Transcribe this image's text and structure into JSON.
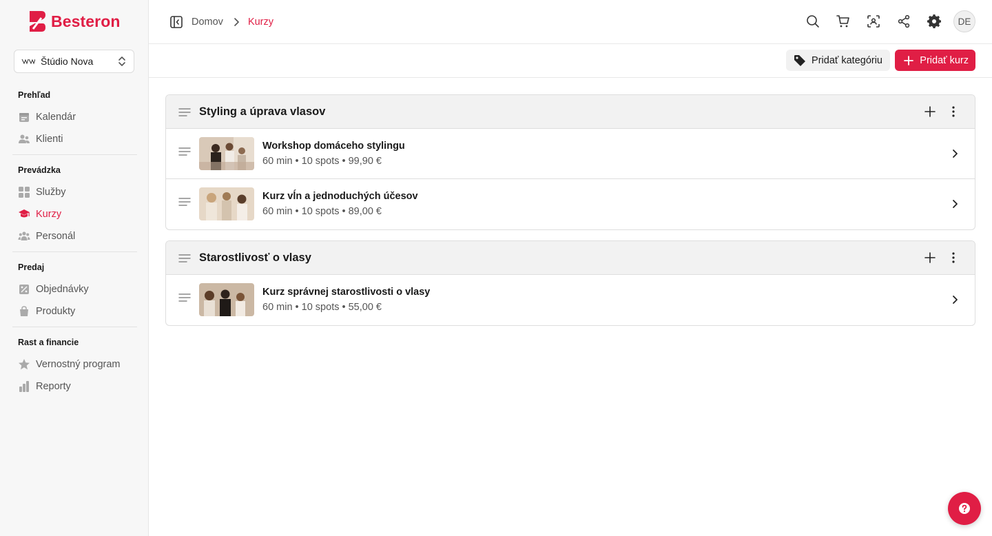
{
  "brand": {
    "name": "Besteron",
    "accent": "#e01e45"
  },
  "studio": {
    "name": "Štúdio Nova"
  },
  "sidebar": {
    "groups": [
      {
        "title": "Prehľad",
        "items": [
          {
            "label": "Kalendár",
            "icon": "calendar-icon"
          },
          {
            "label": "Klienti",
            "icon": "users-icon"
          }
        ]
      },
      {
        "title": "Prevádzka",
        "items": [
          {
            "label": "Služby",
            "icon": "grid-icon"
          },
          {
            "label": "Kurzy",
            "icon": "graduation-cap-icon",
            "active": true
          },
          {
            "label": "Personál",
            "icon": "team-icon"
          }
        ]
      },
      {
        "title": "Predaj",
        "items": [
          {
            "label": "Objednávky",
            "icon": "order-icon"
          },
          {
            "label": "Produkty",
            "icon": "bag-icon"
          }
        ]
      },
      {
        "title": "Rast a financie",
        "items": [
          {
            "label": "Vernostný program",
            "icon": "star-icon"
          },
          {
            "label": "Reporty",
            "icon": "bar-chart-icon"
          }
        ]
      }
    ]
  },
  "breadcrumb": {
    "home": "Domov",
    "current": "Kurzy"
  },
  "topbar": {
    "icons": [
      "search-icon",
      "cart-icon",
      "scan-icon",
      "share-icon",
      "gear-icon"
    ],
    "avatar": "DE"
  },
  "actions": {
    "add_category": "Pridať kategóriu",
    "add_course": "Pridať kurz"
  },
  "categories": [
    {
      "title": "Styling a úprava vlasov",
      "courses": [
        {
          "title": "Workshop domáceho stylingu",
          "meta": "60 min • 10 spots • 99,90 €"
        },
        {
          "title": "Kurz vĺn a jednoduchých účesov",
          "meta": "60 min • 10 spots • 89,00 €"
        }
      ]
    },
    {
      "title": "Starostlivosť o vlasy",
      "courses": [
        {
          "title": "Kurz správnej starostlivosti o vlasy",
          "meta": "60 min • 10 spots • 55,00 €"
        }
      ]
    }
  ]
}
